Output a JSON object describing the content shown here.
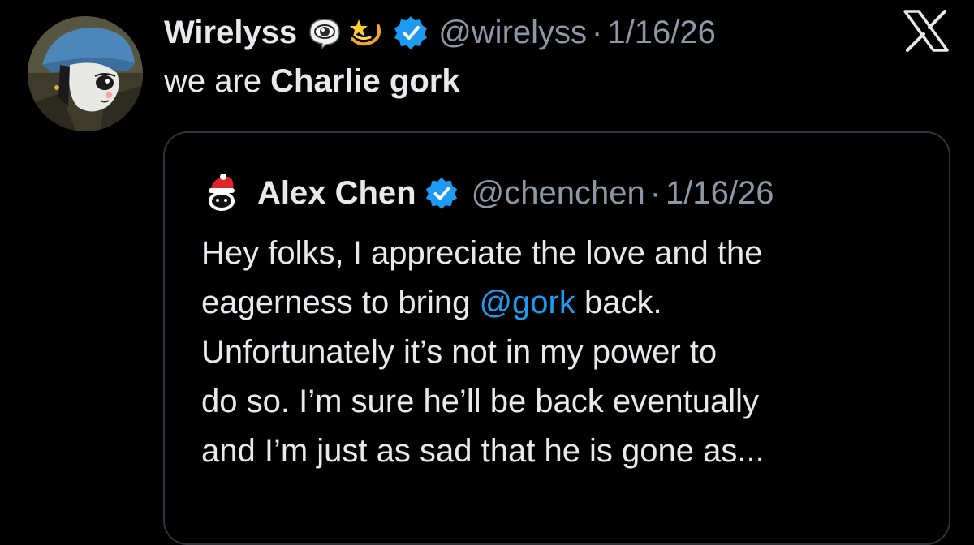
{
  "tweet": {
    "author": {
      "display_name": "Wirelyss",
      "emoji_1": "eye-in-speech-bubble",
      "emoji_2": "dizzy-star",
      "handle": "@wirelyss",
      "verified": true
    },
    "date": "1/16/26",
    "separator": "·",
    "text_prefix": "we are ",
    "text_bold": "Charlie gork",
    "platform_logo": "X"
  },
  "quote": {
    "author": {
      "display_name": "Alex Chen",
      "handle": "@chenchen",
      "avatar_icon": "santa-hat-creature",
      "verified": true
    },
    "date": "1/16/26",
    "separator": "·",
    "lines": {
      "l1": "Hey folks, I appreciate the love and the",
      "l2_before": "eagerness to bring ",
      "l2_mention": "@gork",
      "l2_after": " back.",
      "l3": "Unfortunately it’s not in my power to",
      "l4": "do so. I’m sure he’ll be back eventually",
      "l5": "and I’m just as sad that he is gone as..."
    }
  },
  "colors": {
    "background": "#000000",
    "text": "#e7e9ea",
    "secondary_text": "#8b98a5",
    "link": "#1d9bf0",
    "verified": "#1d9bf0",
    "border": "#2f3336"
  }
}
